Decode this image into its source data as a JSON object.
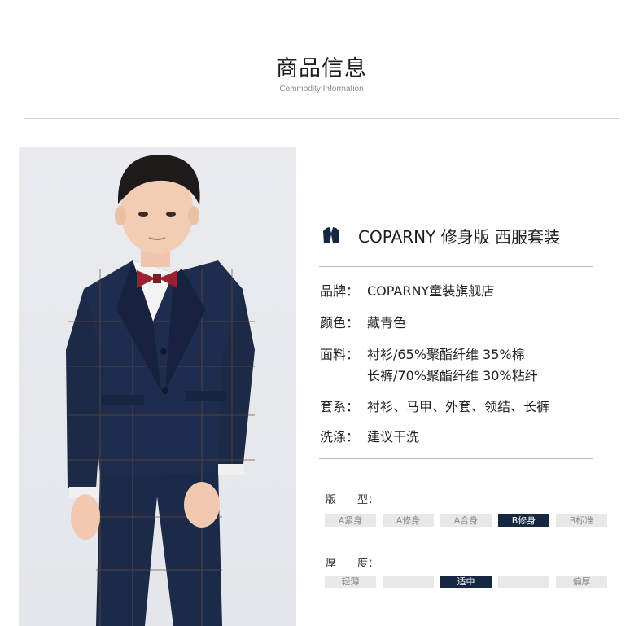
{
  "header": {
    "title": "商品信息",
    "subtitle": "Commodity Information"
  },
  "product": {
    "icon": "suit-jacket-icon",
    "name": "COPARNY 修身版 西服套装"
  },
  "specs": {
    "brand": {
      "label": "品牌：",
      "value": "COPARNY童装旗舰店"
    },
    "color": {
      "label": "颜色：",
      "value": "藏青色"
    },
    "fabric": {
      "label": "面料：",
      "value": "衬衫/65%聚酯纤维 35%棉",
      "value2": "长裤/70%聚酯纤维 30%粘纤"
    },
    "set": {
      "label": "套系：",
      "value": "衬衫、马甲、外套、领结、长裤"
    },
    "wash": {
      "label": "洗涤：",
      "value": "建议干洗"
    }
  },
  "fit": {
    "label": "版　　型：",
    "options": [
      "A紧身",
      "A修身",
      "A合身",
      "B修身",
      "B标准"
    ],
    "selected": "B修身"
  },
  "thickness": {
    "label": "厚　　度：",
    "options": [
      "轻薄",
      "",
      "适中",
      "",
      "偏厚"
    ],
    "selected": "适中"
  },
  "colors": {
    "accent": "#152741",
    "option_bg": "#e8e8e8",
    "rule": "#bfbfbf",
    "suit_navy": "#1c2a4a",
    "bow_tie": "#9a2230"
  }
}
